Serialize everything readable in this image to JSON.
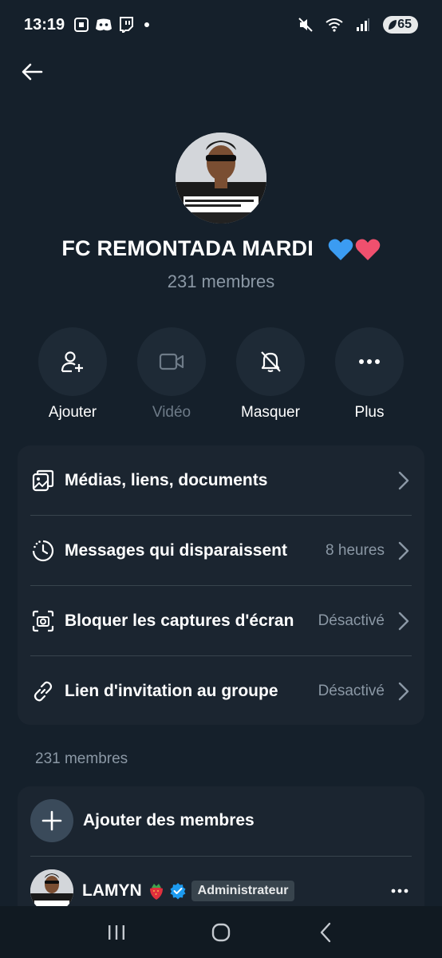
{
  "status_bar": {
    "time": "13:19",
    "battery": "65"
  },
  "group": {
    "title": "FC REMONTADA MARDI",
    "member_count": "231 membres",
    "heart_colors": [
      "#3b9cf2",
      "#f0506e"
    ]
  },
  "actions": [
    {
      "label": "Ajouter",
      "icon": "add-user-icon",
      "enabled": true
    },
    {
      "label": "Vidéo",
      "icon": "video-icon",
      "enabled": false
    },
    {
      "label": "Masquer",
      "icon": "bell-off-icon",
      "enabled": true
    },
    {
      "label": "Plus",
      "icon": "more-horizontal-icon",
      "enabled": true
    }
  ],
  "settings": [
    {
      "label": "Médias, liens, documents",
      "value": "",
      "icon": "media-icon"
    },
    {
      "label": "Messages qui disparaissent",
      "value": "8 heures",
      "icon": "timer-icon"
    },
    {
      "label": "Bloquer les captures d'écran",
      "value": "Désactivé",
      "icon": "camera-icon"
    },
    {
      "label": "Lien d'invitation au groupe",
      "value": "Désactivé",
      "icon": "link-icon"
    }
  ],
  "members_section": {
    "heading": "231 membres",
    "add_label": "Ajouter des membres",
    "members": [
      {
        "name": "LAMYN",
        "role": "Administrateur",
        "verified": true
      }
    ]
  },
  "colors": {
    "background": "#15202b",
    "card": "#1b2530",
    "verified": "#1d9bf0",
    "muted_text": "#8b98a5"
  }
}
